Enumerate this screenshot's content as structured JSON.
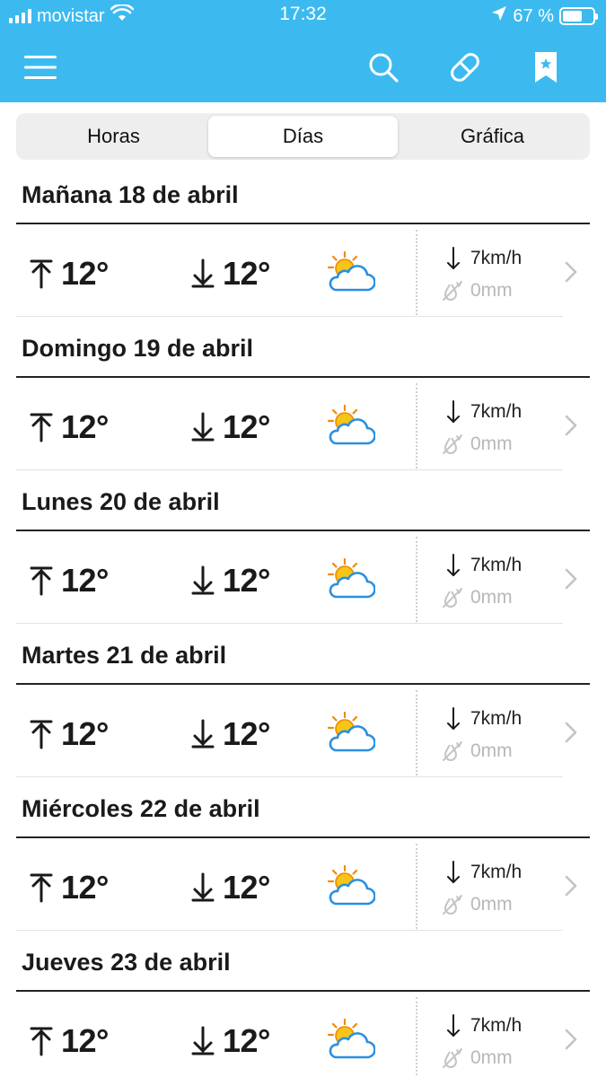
{
  "status": {
    "carrier": "movistar",
    "time": "17:32",
    "battery": "67 %",
    "battery_level": 0.67
  },
  "toolbar": {
    "icons": [
      "menu-icon",
      "search-icon",
      "pill-icon",
      "bookmark-star-icon"
    ]
  },
  "tabs": [
    {
      "label": "Horas",
      "active": false
    },
    {
      "label": "Días",
      "active": true
    },
    {
      "label": "Gráfica",
      "active": false
    }
  ],
  "days": [
    {
      "title": "Mañana 18 de abril",
      "max": "12°",
      "min": "12°",
      "wind": "7km/h",
      "rain": "0mm",
      "icon": "partly-cloudy-icon"
    },
    {
      "title": "Domingo 19 de abril",
      "max": "12°",
      "min": "12°",
      "wind": "7km/h",
      "rain": "0mm",
      "icon": "partly-cloudy-icon"
    },
    {
      "title": "Lunes 20 de abril",
      "max": "12°",
      "min": "12°",
      "wind": "7km/h",
      "rain": "0mm",
      "icon": "partly-cloudy-icon"
    },
    {
      "title": "Martes 21 de abril",
      "max": "12°",
      "min": "12°",
      "wind": "7km/h",
      "rain": "0mm",
      "icon": "partly-cloudy-icon"
    },
    {
      "title": "Miércoles 22 de abril",
      "max": "12°",
      "min": "12°",
      "wind": "7km/h",
      "rain": "0mm",
      "icon": "partly-cloudy-icon"
    },
    {
      "title": "Jueves 23 de abril",
      "max": "12°",
      "min": "12°",
      "wind": "7km/h",
      "rain": "0mm",
      "icon": "partly-cloudy-icon"
    }
  ],
  "colors": {
    "header": "#3cbaf0",
    "sun": "#f5c518",
    "cloud": "#2a8fe0",
    "muted": "#b8b8b8"
  }
}
